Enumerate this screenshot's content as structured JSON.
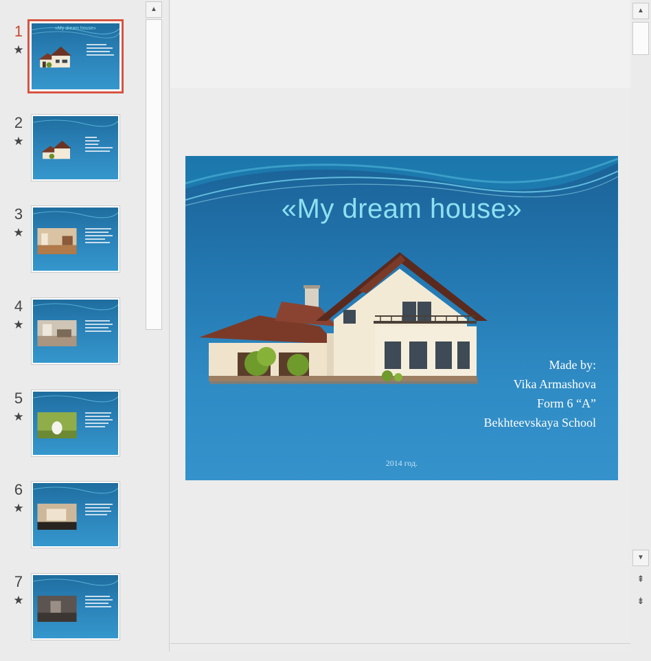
{
  "thumbnails": [
    {
      "number": "1",
      "title": "«My dream house»",
      "active": true
    },
    {
      "number": "2",
      "title": "",
      "active": false
    },
    {
      "number": "3",
      "title": "",
      "active": false
    },
    {
      "number": "4",
      "title": "",
      "active": false
    },
    {
      "number": "5",
      "title": "",
      "active": false
    },
    {
      "number": "6",
      "title": "",
      "active": false
    },
    {
      "number": "7",
      "title": "",
      "active": false
    }
  ],
  "star_glyph": "★",
  "slide": {
    "title": "«My dream house»",
    "author_lines": [
      "Made by:",
      "Vika Armashova",
      "Form 6 “A”",
      "Bekhteevskaya School"
    ],
    "footer": "2014 год."
  },
  "scrollbar": {
    "up_glyph": "▲",
    "down_glyph": "▼",
    "prev_slide_glyph": "⇞",
    "next_slide_glyph": "⇟"
  },
  "colors": {
    "active_accent": "#d6533f",
    "slide_title": "#8ee0f2",
    "slide_background": "#2377b0"
  },
  "icons": [
    "star-icon",
    "scroll-up-icon",
    "scroll-down-icon",
    "previous-slide-icon",
    "next-slide-icon"
  ]
}
